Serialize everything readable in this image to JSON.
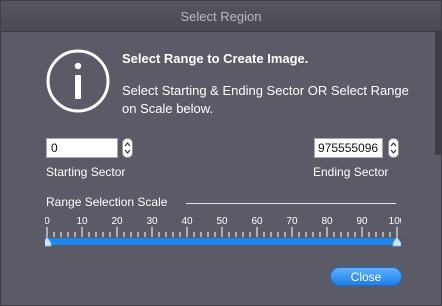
{
  "window": {
    "title": "Select Region"
  },
  "dialog": {
    "heading": "Select Range to Create Image.",
    "description": "Select Starting & Ending Sector OR Select Range on Scale below."
  },
  "start_sector": {
    "value": "0",
    "label": "Starting Sector"
  },
  "end_sector": {
    "value": "975555096",
    "label": "Ending Sector"
  },
  "scale": {
    "label": "Range Selection Scale",
    "ticks": [
      "0",
      "10",
      "20",
      "30",
      "40",
      "50",
      "60",
      "70",
      "80",
      "90",
      "100"
    ],
    "selection_start_percent": 0,
    "selection_end_percent": 100
  },
  "buttons": {
    "close": "Close"
  },
  "colors": {
    "accent": "#1d7fe8",
    "background": "#5b5b67"
  }
}
